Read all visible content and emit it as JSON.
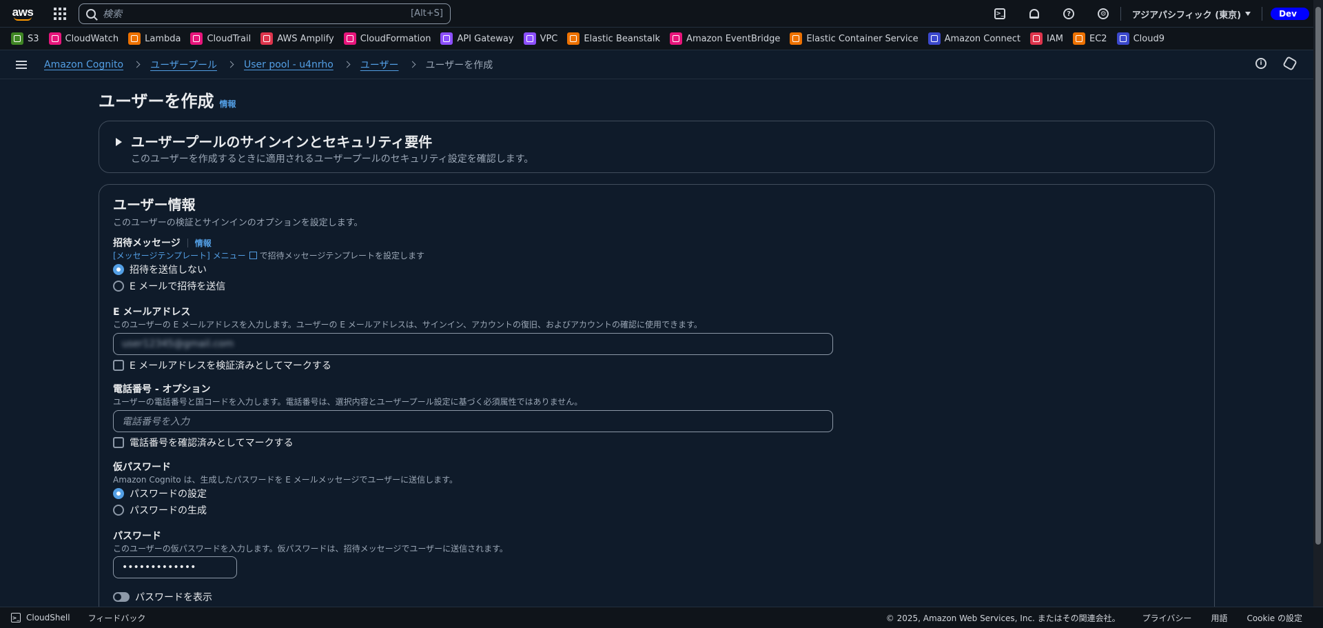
{
  "topnav": {
    "logo_text": "aws",
    "search_placeholder": "検索",
    "search_shortcut": "[Alt+S]",
    "region": "アジアパシフィック (東京)",
    "account_badge": "Dev"
  },
  "favorites": [
    {
      "label": "S3",
      "color": "#3f8624"
    },
    {
      "label": "CloudWatch",
      "color": "#e7157b"
    },
    {
      "label": "Lambda",
      "color": "#ed7100"
    },
    {
      "label": "CloudTrail",
      "color": "#e7157b"
    },
    {
      "label": "AWS Amplify",
      "color": "#dd344c"
    },
    {
      "label": "CloudFormation",
      "color": "#e7157b"
    },
    {
      "label": "API Gateway",
      "color": "#8c4fff"
    },
    {
      "label": "VPC",
      "color": "#8c4fff"
    },
    {
      "label": "Elastic Beanstalk",
      "color": "#ed7100"
    },
    {
      "label": "Amazon EventBridge",
      "color": "#e7157b"
    },
    {
      "label": "Elastic Container Service",
      "color": "#ed7100"
    },
    {
      "label": "Amazon Connect",
      "color": "#3b48cc"
    },
    {
      "label": "IAM",
      "color": "#dd344c"
    },
    {
      "label": "EC2",
      "color": "#ed7100"
    },
    {
      "label": "Cloud9",
      "color": "#3b48cc"
    }
  ],
  "breadcrumb": {
    "items": [
      "Amazon Cognito",
      "ユーザープール",
      "User pool - u4nrho",
      "ユーザー"
    ],
    "current": "ユーザーを作成"
  },
  "page": {
    "title": "ユーザーを作成",
    "info": "情報"
  },
  "security_section": {
    "title": "ユーザープールのサインインとセキュリティ要件",
    "description": "このユーザーを作成するときに適用されるユーザープールのセキュリティ設定を確認します。"
  },
  "user_info": {
    "title": "ユーザー情報",
    "description": "このユーザーの検証とサインインのオプションを設定します。",
    "invitation": {
      "label": "招待メッセージ",
      "info": "情報",
      "hint_link": "[メッセージテンプレート] メニュー",
      "hint_rest": "で招待メッセージテンプレートを設定します",
      "options": [
        "招待を送信しない",
        "E メールで招待を送信"
      ],
      "selected": 0
    },
    "email": {
      "label": "E メールアドレス",
      "hint": "このユーザーの E メールアドレスを入力します。ユーザーの E メールアドレスは、サインイン、アカウントの復旧、およびアカウントの確認に使用できます。",
      "value": "user12345@gmail.com",
      "verify_label": "E メールアドレスを検証済みとしてマークする"
    },
    "phone": {
      "label": "電話番号 - オプション",
      "hint": "ユーザーの電話番号と国コードを入力します。電話番号は、選択内容とユーザープール設定に基づく必須属性ではありません。",
      "placeholder": "電話番号を入力",
      "verify_label": "電話番号を確認済みとしてマークする"
    },
    "temp_password": {
      "label": "仮パスワード",
      "hint": "Amazon Cognito は、生成したパスワードを E メールメッセージでユーザーに送信します。",
      "options": [
        "パスワードの設定",
        "パスワードの生成"
      ],
      "selected": 0
    },
    "password": {
      "label": "パスワード",
      "hint": "このユーザーの仮パスワードを入力します。仮パスワードは、招待メッセージでユーザーに送信されます。",
      "value": "•••••••••••••",
      "show_label": "パスワードを表示"
    }
  },
  "footer": {
    "cloudshell": "CloudShell",
    "feedback": "フィードバック",
    "copyright": "© 2025, Amazon Web Services, Inc. またはその関連会社。",
    "privacy": "プライバシー",
    "terms": "用語",
    "cookies": "Cookie の設定"
  }
}
